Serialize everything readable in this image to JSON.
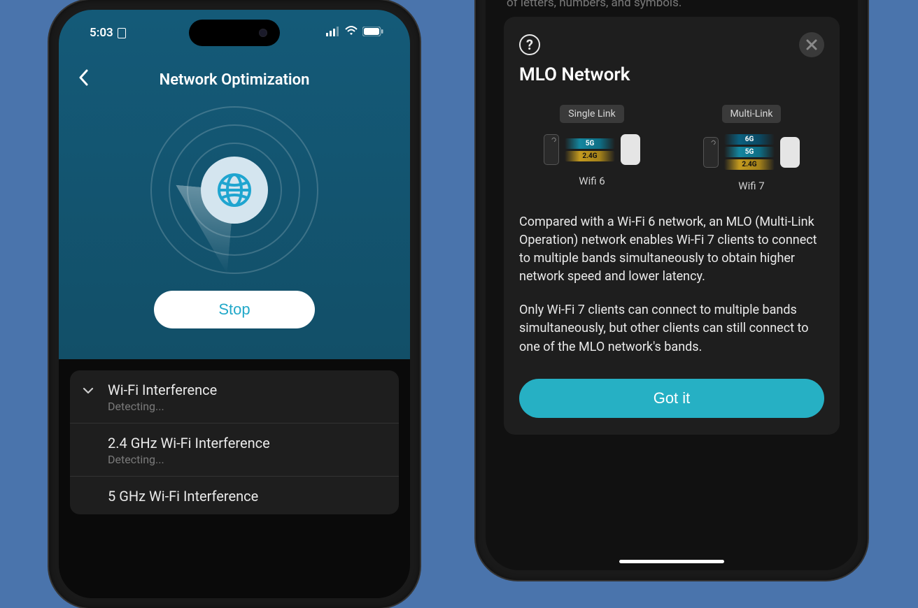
{
  "left": {
    "status": {
      "time": "5:03",
      "signal_icon": "cellular-signal-icon",
      "wifi_icon": "wifi-icon",
      "battery_icon": "battery-icon"
    },
    "nav": {
      "title": "Network Optimization",
      "back_label": "Back"
    },
    "stop_label": "Stop",
    "list": [
      {
        "title": "Wi-Fi Interference",
        "sub": "Detecting...",
        "expanded": true
      },
      {
        "title": "2.4 GHz Wi-Fi Interference",
        "sub": "Detecting...",
        "expanded": false
      },
      {
        "title": "5 GHz Wi-Fi Interference",
        "sub": "",
        "expanded": false
      }
    ]
  },
  "right": {
    "hint": "of letters, numbers, and symbols.",
    "title": "MLO Network",
    "diagram": {
      "cols": [
        {
          "tag": "Single Link",
          "bands": [
            "5G",
            "2.4G"
          ],
          "label": "Wifi 6"
        },
        {
          "tag": "Multi-Link",
          "bands": [
            "6G",
            "5G",
            "2.4G"
          ],
          "label": "Wifi 7"
        }
      ]
    },
    "paragraphs": [
      "Compared with a Wi-Fi 6 network, an MLO (Multi-Link Operation) network enables Wi-Fi 7 clients to connect to multiple bands simultaneously to obtain higher network speed and lower latency.",
      "Only Wi-Fi 7 clients can connect to multiple bands simultaneously, but other clients can still connect to one of the MLO network's bands."
    ],
    "gotit_label": "Got it"
  }
}
